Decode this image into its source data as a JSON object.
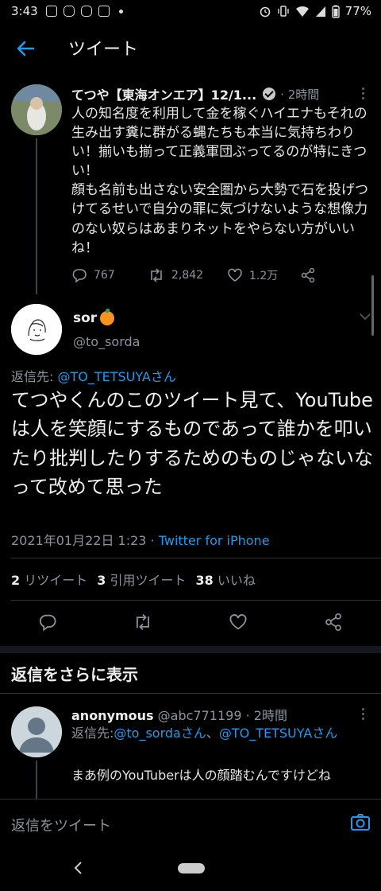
{
  "status_bar": {
    "time": "3:43",
    "battery": "77%"
  },
  "header": {
    "title": "ツイート"
  },
  "original_tweet": {
    "name": "てつや【東海オンエア】12/1...",
    "time": "· 2時間",
    "text": "人の知名度を利用して金を稼ぐハイエナもそれの生み出す糞に群がる蝿たちも本当に気持ちわりい！揃いも揃って正義軍団ぶってるのが特にきつい！\n顔も名前も出さない安全圏から大勢で石を投げつけてるせいで自分の罪に気づけないような想像力のない奴らはあまりネットをやらない方がいいね！",
    "replies": "767",
    "retweets": "2,842",
    "likes": "1.2万"
  },
  "main_tweet": {
    "name": "sor",
    "handle": "@to_sorda",
    "reply_prefix": "返信先:",
    "reply_to": "@TO_TETSUYAさん",
    "text": "てつやくんのこのツイート見て、YouTubeは人を笑顔にするものであって誰かを叩いたり批判したりするためのものじゃないなって改めて思った",
    "date": "2021年01月22日 1:23 ·",
    "source": "Twitter for iPhone",
    "stats": {
      "retweets_count": "2",
      "retweets_label": "リツイート",
      "quotes_count": "3",
      "quotes_label": "引用ツイート",
      "likes_count": "38",
      "likes_label": "いいね"
    }
  },
  "more_replies_label": "返信をさらに表示",
  "reply_tweet": {
    "name": "anonymous",
    "handle_time": "@abc771199 · 2時間",
    "reply_prefix": "返信先:",
    "reply_to_1": "@to_sordaさん",
    "reply_sep": "、",
    "reply_to_2": "@TO_TETSUYAさん",
    "text": "まあ例のYouTuberは人の顔踏むんですけどね"
  },
  "compose": {
    "placeholder": "返信をツイート"
  },
  "colors": {
    "background": "#000000",
    "accent": "#1d9bf0",
    "muted": "#8b949e"
  }
}
